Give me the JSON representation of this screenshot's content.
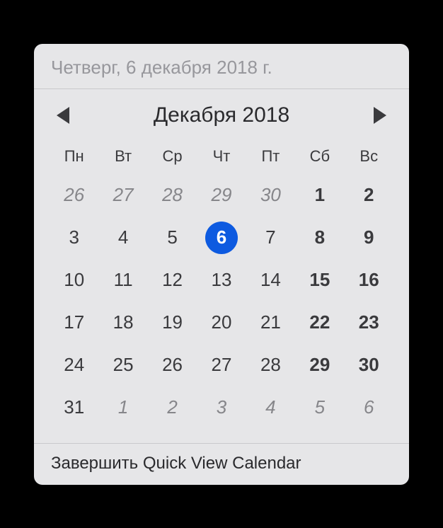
{
  "header": {
    "full_date": "Четверг, 6 декабря 2018 г."
  },
  "nav": {
    "month_label": "Декабря 2018"
  },
  "weekdays": [
    "Пн",
    "Вт",
    "Ср",
    "Чт",
    "Пт",
    "Сб",
    "Вс"
  ],
  "weeks": [
    [
      {
        "day": "26",
        "other": true,
        "weekend": false,
        "today": false
      },
      {
        "day": "27",
        "other": true,
        "weekend": false,
        "today": false
      },
      {
        "day": "28",
        "other": true,
        "weekend": false,
        "today": false
      },
      {
        "day": "29",
        "other": true,
        "weekend": false,
        "today": false
      },
      {
        "day": "30",
        "other": true,
        "weekend": false,
        "today": false
      },
      {
        "day": "1",
        "other": false,
        "weekend": true,
        "today": false
      },
      {
        "day": "2",
        "other": false,
        "weekend": true,
        "today": false
      }
    ],
    [
      {
        "day": "3",
        "other": false,
        "weekend": false,
        "today": false
      },
      {
        "day": "4",
        "other": false,
        "weekend": false,
        "today": false
      },
      {
        "day": "5",
        "other": false,
        "weekend": false,
        "today": false
      },
      {
        "day": "6",
        "other": false,
        "weekend": false,
        "today": true
      },
      {
        "day": "7",
        "other": false,
        "weekend": false,
        "today": false
      },
      {
        "day": "8",
        "other": false,
        "weekend": true,
        "today": false
      },
      {
        "day": "9",
        "other": false,
        "weekend": true,
        "today": false
      }
    ],
    [
      {
        "day": "10",
        "other": false,
        "weekend": false,
        "today": false
      },
      {
        "day": "11",
        "other": false,
        "weekend": false,
        "today": false
      },
      {
        "day": "12",
        "other": false,
        "weekend": false,
        "today": false
      },
      {
        "day": "13",
        "other": false,
        "weekend": false,
        "today": false
      },
      {
        "day": "14",
        "other": false,
        "weekend": false,
        "today": false
      },
      {
        "day": "15",
        "other": false,
        "weekend": true,
        "today": false
      },
      {
        "day": "16",
        "other": false,
        "weekend": true,
        "today": false
      }
    ],
    [
      {
        "day": "17",
        "other": false,
        "weekend": false,
        "today": false
      },
      {
        "day": "18",
        "other": false,
        "weekend": false,
        "today": false
      },
      {
        "day": "19",
        "other": false,
        "weekend": false,
        "today": false
      },
      {
        "day": "20",
        "other": false,
        "weekend": false,
        "today": false
      },
      {
        "day": "21",
        "other": false,
        "weekend": false,
        "today": false
      },
      {
        "day": "22",
        "other": false,
        "weekend": true,
        "today": false
      },
      {
        "day": "23",
        "other": false,
        "weekend": true,
        "today": false
      }
    ],
    [
      {
        "day": "24",
        "other": false,
        "weekend": false,
        "today": false
      },
      {
        "day": "25",
        "other": false,
        "weekend": false,
        "today": false
      },
      {
        "day": "26",
        "other": false,
        "weekend": false,
        "today": false
      },
      {
        "day": "27",
        "other": false,
        "weekend": false,
        "today": false
      },
      {
        "day": "28",
        "other": false,
        "weekend": false,
        "today": false
      },
      {
        "day": "29",
        "other": false,
        "weekend": true,
        "today": false
      },
      {
        "day": "30",
        "other": false,
        "weekend": true,
        "today": false
      }
    ],
    [
      {
        "day": "31",
        "other": false,
        "weekend": false,
        "today": false
      },
      {
        "day": "1",
        "other": true,
        "weekend": false,
        "today": false
      },
      {
        "day": "2",
        "other": true,
        "weekend": false,
        "today": false
      },
      {
        "day": "3",
        "other": true,
        "weekend": false,
        "today": false
      },
      {
        "day": "4",
        "other": true,
        "weekend": false,
        "today": false
      },
      {
        "day": "5",
        "other": true,
        "weekend": true,
        "today": false
      },
      {
        "day": "6",
        "other": true,
        "weekend": true,
        "today": false
      }
    ]
  ],
  "footer": {
    "quit_label": "Завершить Quick View Calendar"
  },
  "colors": {
    "today_bg": "#0d5ae0",
    "widget_bg": "#e6e6e8"
  }
}
